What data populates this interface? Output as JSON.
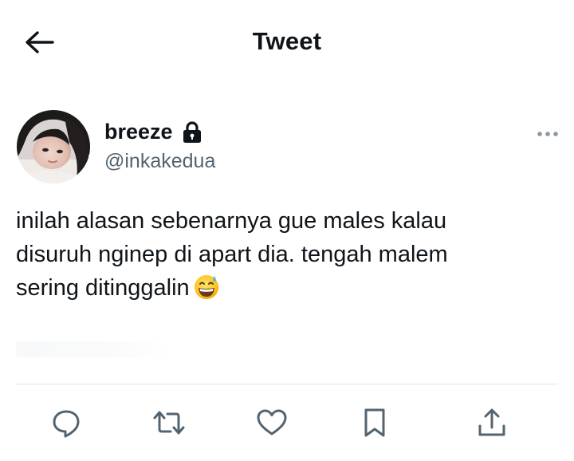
{
  "header": {
    "title": "Tweet",
    "back_icon": "arrow-left-icon"
  },
  "author": {
    "display_name": "breeze",
    "handle": "@inkakedua",
    "protected_icon": "lock-icon"
  },
  "tweet": {
    "lines": [
      "inilah alasan sebenarnya gue males kalau",
      "disuruh nginep di apart dia. tengah malem",
      "sering ditinggalin"
    ],
    "trailing_emoji": "grinning-face-with-sweat-emoji"
  },
  "actions": [
    {
      "name": "reply",
      "icon": "reply-icon"
    },
    {
      "name": "retweet",
      "icon": "retweet-icon"
    },
    {
      "name": "like",
      "icon": "heart-icon"
    },
    {
      "name": "bookmark",
      "icon": "bookmark-icon"
    },
    {
      "name": "share",
      "icon": "share-icon"
    }
  ],
  "colors": {
    "text_primary": "#0f1419",
    "text_secondary": "#536471",
    "icon": "#536471",
    "divider": "#dfe3e7",
    "background": "#ffffff"
  }
}
